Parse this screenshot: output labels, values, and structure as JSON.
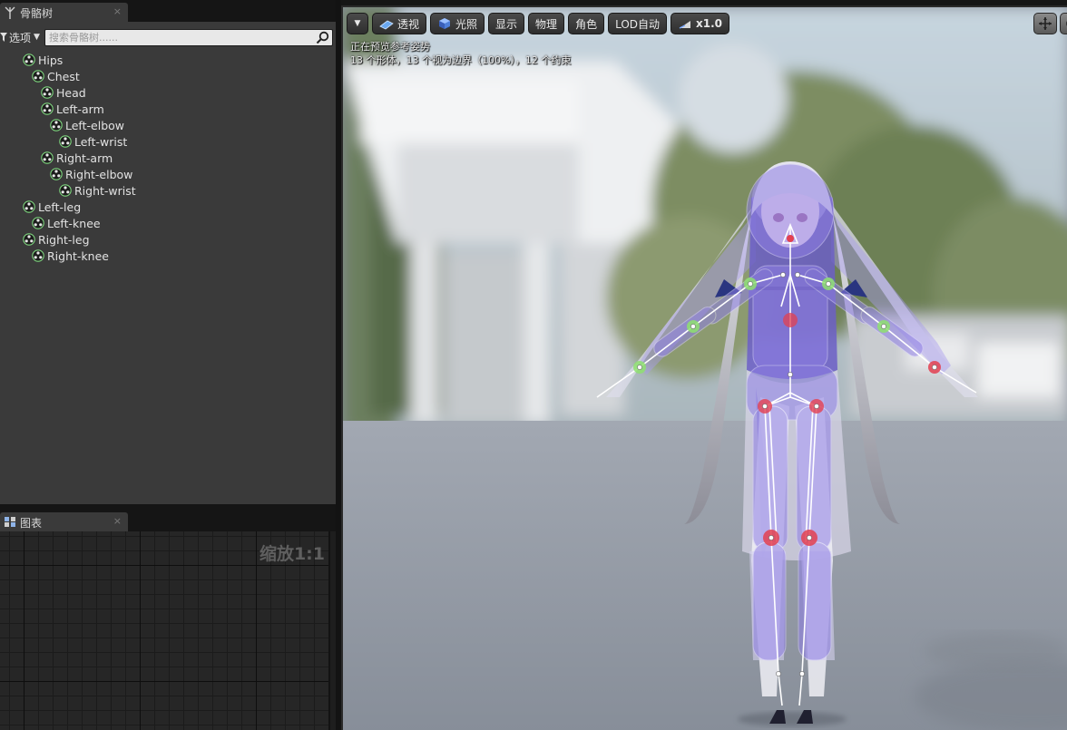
{
  "skeleton_tab": {
    "title": "骨骼树",
    "close": "×"
  },
  "tree_toolbar": {
    "options_label": "选项",
    "search_placeholder": "搜索骨骼树......"
  },
  "bones": [
    {
      "name": "Hips",
      "depth": 0
    },
    {
      "name": "Chest",
      "depth": 1
    },
    {
      "name": "Head",
      "depth": 2
    },
    {
      "name": "Left-arm",
      "depth": 2
    },
    {
      "name": "Left-elbow",
      "depth": 3
    },
    {
      "name": "Left-wrist",
      "depth": 4
    },
    {
      "name": "Right-arm",
      "depth": 2
    },
    {
      "name": "Right-elbow",
      "depth": 3
    },
    {
      "name": "Right-wrist",
      "depth": 4
    },
    {
      "name": "Left-leg",
      "depth": 0
    },
    {
      "name": "Left-knee",
      "depth": 1
    },
    {
      "name": "Right-leg",
      "depth": 0
    },
    {
      "name": "Right-knee",
      "depth": 1
    }
  ],
  "graph_tab": {
    "title": "图表",
    "close": "×"
  },
  "graph": {
    "zoom_label": "缩放1:1"
  },
  "viewport": {
    "buttons": {
      "perspective": "透视",
      "lighting": "光照",
      "show": "显示",
      "physics": "物理",
      "character": "角色",
      "lod": "LOD自动",
      "speed": "x1.0"
    },
    "info_line1": "正在预览参考姿势",
    "info_line2": "13 个形体，13 个视为边界（100%），12 个约束"
  },
  "colors": {
    "bone_icon_green": "#7fd67f",
    "joint_red": "#e34050",
    "joint_green": "#8ee070",
    "body_overlay": "#8f7fe6"
  }
}
